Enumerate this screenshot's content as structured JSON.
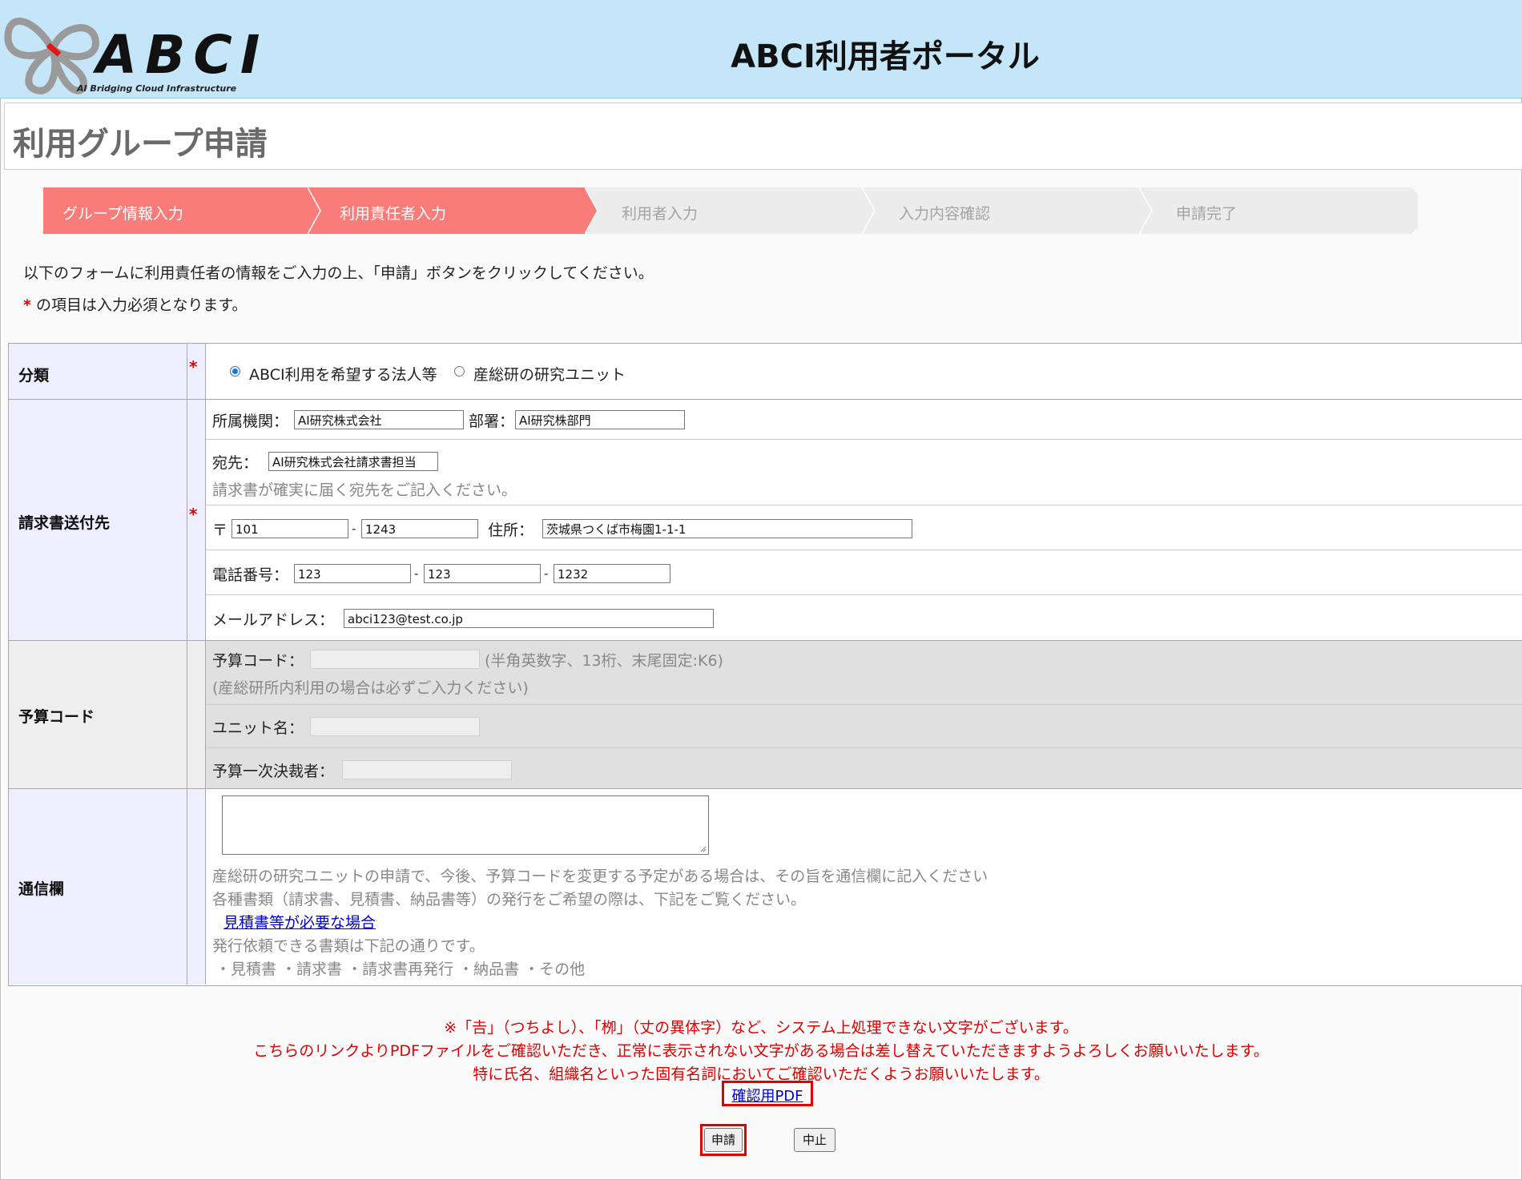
{
  "header": {
    "logo_text": "ABCI",
    "logo_subtitle": "AI Bridging Cloud Infrastructure",
    "portal_title": "ABCI利用者ポータル"
  },
  "page": {
    "title": "利用グループ申請"
  },
  "steps": [
    {
      "label": "グループ情報入力",
      "state": "active"
    },
    {
      "label": "利用責任者入力",
      "state": "active"
    },
    {
      "label": "利用者入力",
      "state": "inactive"
    },
    {
      "label": "入力内容確認",
      "state": "inactive"
    },
    {
      "label": "申請完了",
      "state": "inactive"
    }
  ],
  "instructions": {
    "line1": "以下のフォームに利用責任者の情報をご入力の上、「申請」ボタンをクリックしてください。",
    "required_mark": "*",
    "line2": " の項目は入力必須となります。"
  },
  "form": {
    "category": {
      "label": "分類",
      "required": "*",
      "options": [
        "ABCI利用を希望する法人等",
        "産総研の研究ユニット"
      ],
      "selected_index": 0
    },
    "invoice": {
      "label": "請求書送付先",
      "required": "*",
      "org_label": "所属機関：",
      "org_value": "AI研究株式会社",
      "dept_label": "部署：",
      "dept_value": "AI研究株部門",
      "addressee_label": "宛先：",
      "addressee_value": "AI研究株式会社請求書担当",
      "addressee_hint": "請求書が確実に届く宛先をご記入ください。",
      "zip_label": "〒",
      "zip1": "101",
      "zip2": "1243",
      "dash": "-",
      "address_label": "住所：",
      "address_value": "茨城県つくば市梅園1-1-1",
      "phone_label": "電話番号：",
      "phone1": "123",
      "phone2": "123",
      "phone3": "1232",
      "email_label": "メールアドレス：",
      "email_value": "abci123@test.co.jp"
    },
    "budget": {
      "label": "予算コード",
      "code_label": "予算コード：",
      "code_hint": "(半角英数字、13桁、末尾固定:K6)",
      "code_note": "(産総研所内利用の場合は必ずご入力ください)",
      "unit_label": "ユニット名：",
      "approver_label": "予算一次決裁者："
    },
    "comm": {
      "label": "通信欄",
      "hint1": "産総研の研究ユニットの申請で、今後、予算コードを変更する予定がある場合は、その旨を通信欄に記入ください",
      "hint2": "各種書類（請求書、見積書、納品書等）の発行をご希望の際は、下記をご覧ください。",
      "link": "見積書等が必要な場合",
      "hint3": "発行依頼できる書類は下記の通りです。",
      "docs": "・見積書 ・請求書 ・請求書再発行 ・納品書 ・その他"
    }
  },
  "notes": {
    "line1": "※「𠮷」（つちよし）、「栁」（丈の異体字）など、システム上処理できない文字がございます。",
    "line2": "こちらのリンクよりPDFファイルをご確認いただき、正常に表示されない文字がある場合は差し替えていただきますようよろしくお願いいたします。",
    "line3": "特に氏名、組織名といった固有名詞においてご確認いただくようお願いいたします。",
    "pdf_link": "確認用PDF"
  },
  "buttons": {
    "submit": "申請",
    "cancel": "中止"
  },
  "colors": {
    "header_bg": "#c4e6f8",
    "step_active": "#f87c7a",
    "step_inactive": "#ececec",
    "required": "#e00000",
    "link": "#0000cc"
  }
}
